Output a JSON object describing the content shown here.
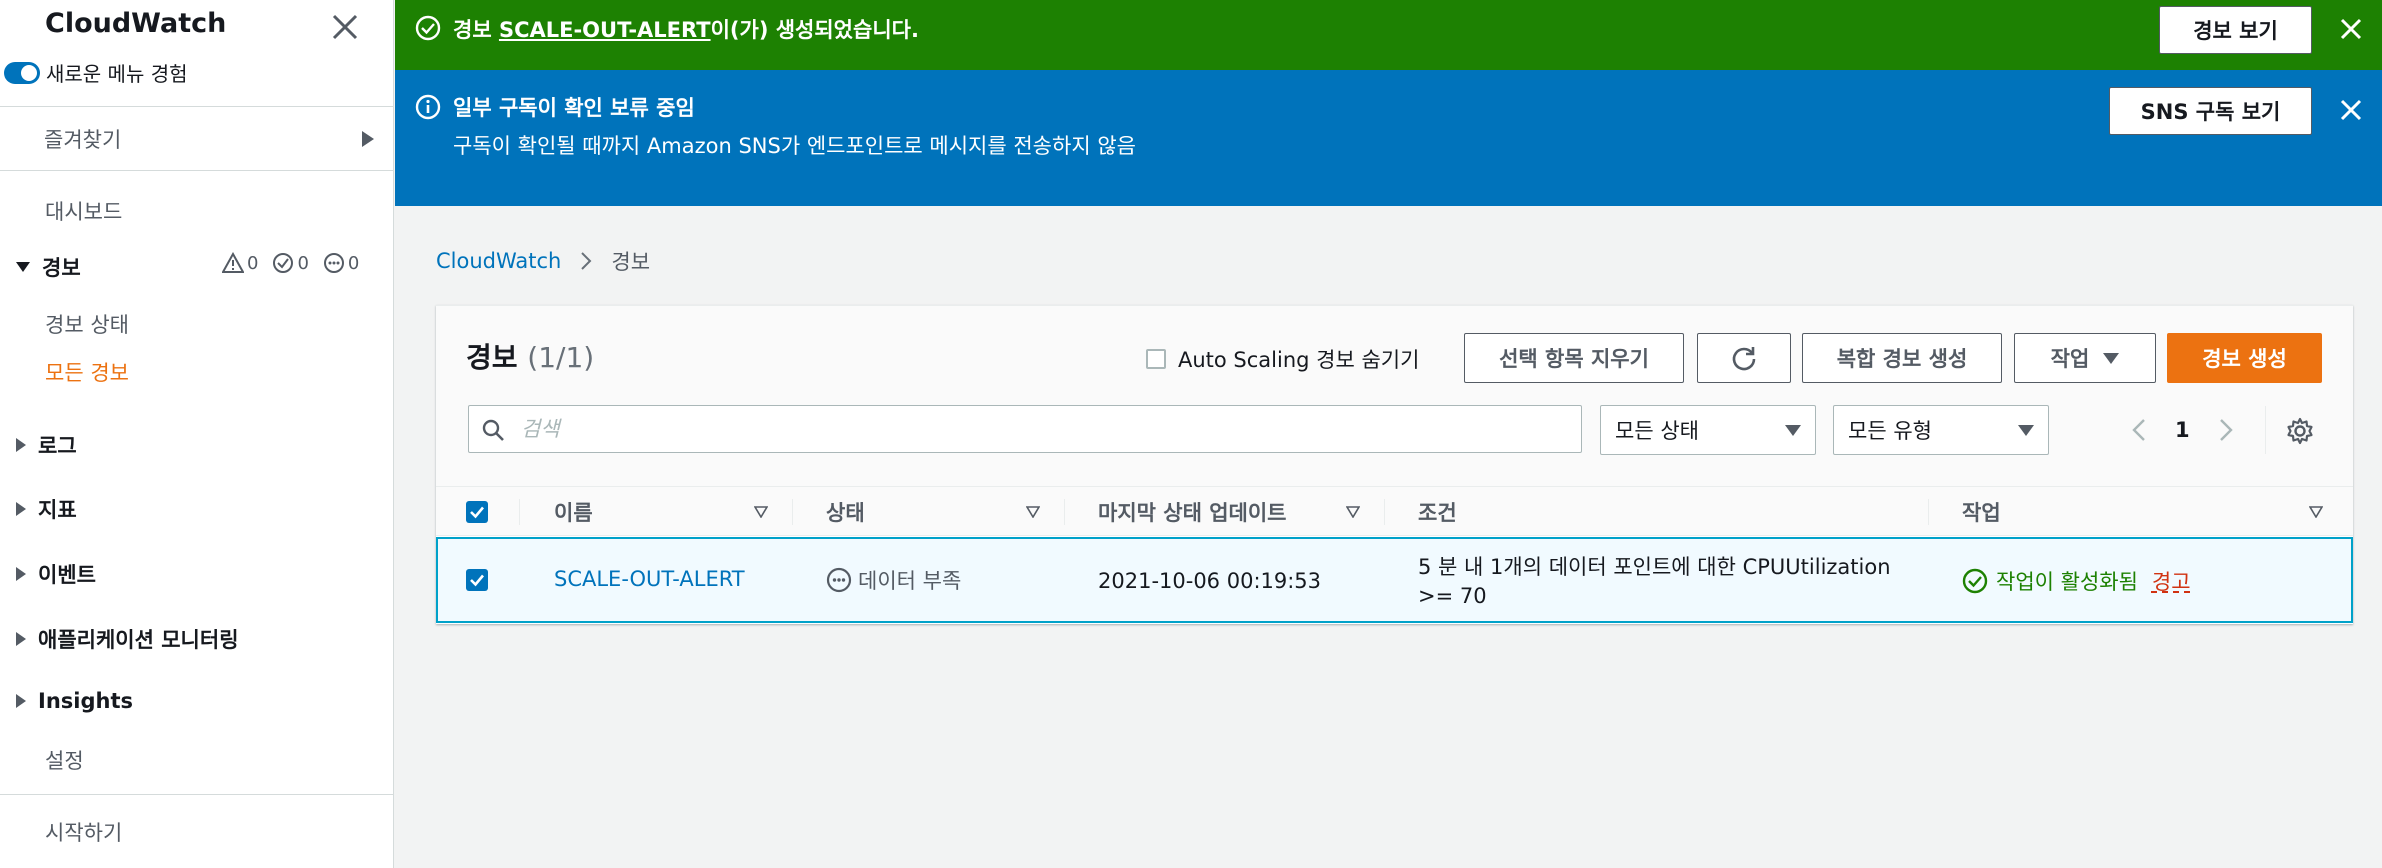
{
  "sidebar": {
    "title": "CloudWatch",
    "toggle_label": "새로운 메뉴 경험",
    "favorites": "즐겨찾기",
    "dashboard": "대시보드",
    "alarms_group": "경보",
    "alarm_counts": {
      "alarm": "0",
      "ok": "0",
      "insufficient": "0"
    },
    "alarm_state": "경보 상태",
    "all_alarms": "모든 경보",
    "logs": "로그",
    "metrics": "지표",
    "events": "이벤트",
    "app_monitoring": "애플리케이션 모니터링",
    "insights": "Insights",
    "settings": "설정",
    "getting_started": "시작하기"
  },
  "flash_success": {
    "prefix": "경보 ",
    "alarm_name": "SCALE-OUT-ALERT",
    "suffix": "이(가) 생성되었습니다.",
    "button": "경보 보기"
  },
  "flash_info": {
    "title": "일부 구독이 확인 보류 중임",
    "message": "구독이 확인될 때까지 Amazon SNS가 엔드포인트로 메시지를 전송하지 않음",
    "button": "SNS 구독 보기"
  },
  "breadcrumb": {
    "root": "CloudWatch",
    "current": "경보"
  },
  "panel": {
    "title": "경보",
    "count": "(1/1)",
    "hide_autoscaling": "Auto Scaling 경보 숨기기",
    "clear_selection": "선택 항목 지우기",
    "create_composite": "복합 경보 생성",
    "actions": "작업",
    "create_alarm": "경보 생성",
    "search_placeholder": "검색",
    "state_filter": "모든 상태",
    "type_filter": "모든 유형",
    "page": "1"
  },
  "table": {
    "columns": [
      "이름",
      "상태",
      "마지막 상태 업데이트",
      "조건",
      "작업"
    ],
    "rows": [
      {
        "name": "SCALE-OUT-ALERT",
        "state": "데이터 부족",
        "last_update": "2021-10-06 00:19:53",
        "condition_line1": "5 분 내 1개의 데이터 포인트에 대한 CPUUtilization",
        "condition_line2": ">= 70",
        "actions_status": "작업이 활성화됨",
        "actions_warning": "경고"
      }
    ]
  },
  "colors": {
    "success": "#1d8102",
    "info": "#0073bb",
    "primary": "#ec7211",
    "link": "#0073bb"
  }
}
